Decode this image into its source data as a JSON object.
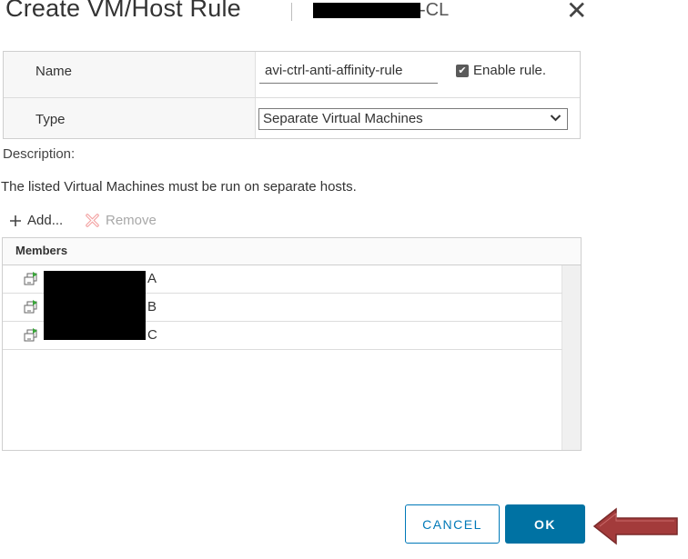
{
  "dialog": {
    "title": "Create VM/Host Rule",
    "cluster_suffix": "-CL"
  },
  "form": {
    "name_label": "Name",
    "name_value": "avi-ctrl-anti-affinity-rule",
    "enable_label": "Enable rule.",
    "enable_checked": true,
    "type_label": "Type",
    "type_value": "Separate Virtual Machines"
  },
  "description": {
    "label": "Description:",
    "text": "The listed Virtual Machines must be run on separate hosts."
  },
  "toolbar": {
    "add_label": "Add...",
    "remove_label": "Remove"
  },
  "members": {
    "header": "Members",
    "rows": [
      {
        "suffix": "A"
      },
      {
        "suffix": "B"
      },
      {
        "suffix": "C"
      }
    ]
  },
  "buttons": {
    "cancel": "CANCEL",
    "ok": "OK"
  },
  "colors": {
    "primary": "#0072a3",
    "arrow": "#9e3a3a"
  }
}
